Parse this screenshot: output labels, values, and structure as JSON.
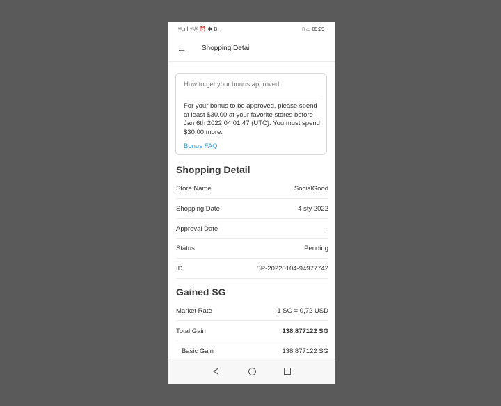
{
  "status_bar": {
    "left": "ᵛᵒ.ıll ᵒᵏ/ˢ ⏰ ✱ B.",
    "right": "▯ ▭ 09:29"
  },
  "header": {
    "title": "Shopping Detail"
  },
  "bonus_card": {
    "heading": "How to get your bonus approved",
    "text": "For your bonus to be approved, please spend at least $30.00 at your favorite stores before Jan 6th 2022 04:01:47 (UTC). You must spend $30.00 more.",
    "link": "Bonus FAQ"
  },
  "shopping_detail": {
    "title": "Shopping Detail",
    "rows": [
      {
        "label": "Store Name",
        "value": "SocialGood"
      },
      {
        "label": "Shopping Date",
        "value": "4 sty 2022"
      },
      {
        "label": "Approval Date",
        "value": "--"
      },
      {
        "label": "Status",
        "value": "Pending"
      },
      {
        "label": "ID",
        "value": "SP-20220104-94977742"
      }
    ]
  },
  "gained_sg": {
    "title": "Gained SG",
    "rows": [
      {
        "label": "Market Rate",
        "value": "1 SG = 0,72 USD"
      },
      {
        "label": "Total Gain",
        "value": "138,877122 SG"
      },
      {
        "label": "Basic Gain",
        "value": "138,877122 SG"
      }
    ]
  },
  "icons": {
    "back": "arrow-left-icon",
    "nav_back": "triangle-back-icon",
    "nav_home": "circle-home-icon",
    "nav_recent": "square-recent-icon"
  },
  "colors": {
    "link": "#2a9bd5",
    "background": "#5a5a5a"
  }
}
